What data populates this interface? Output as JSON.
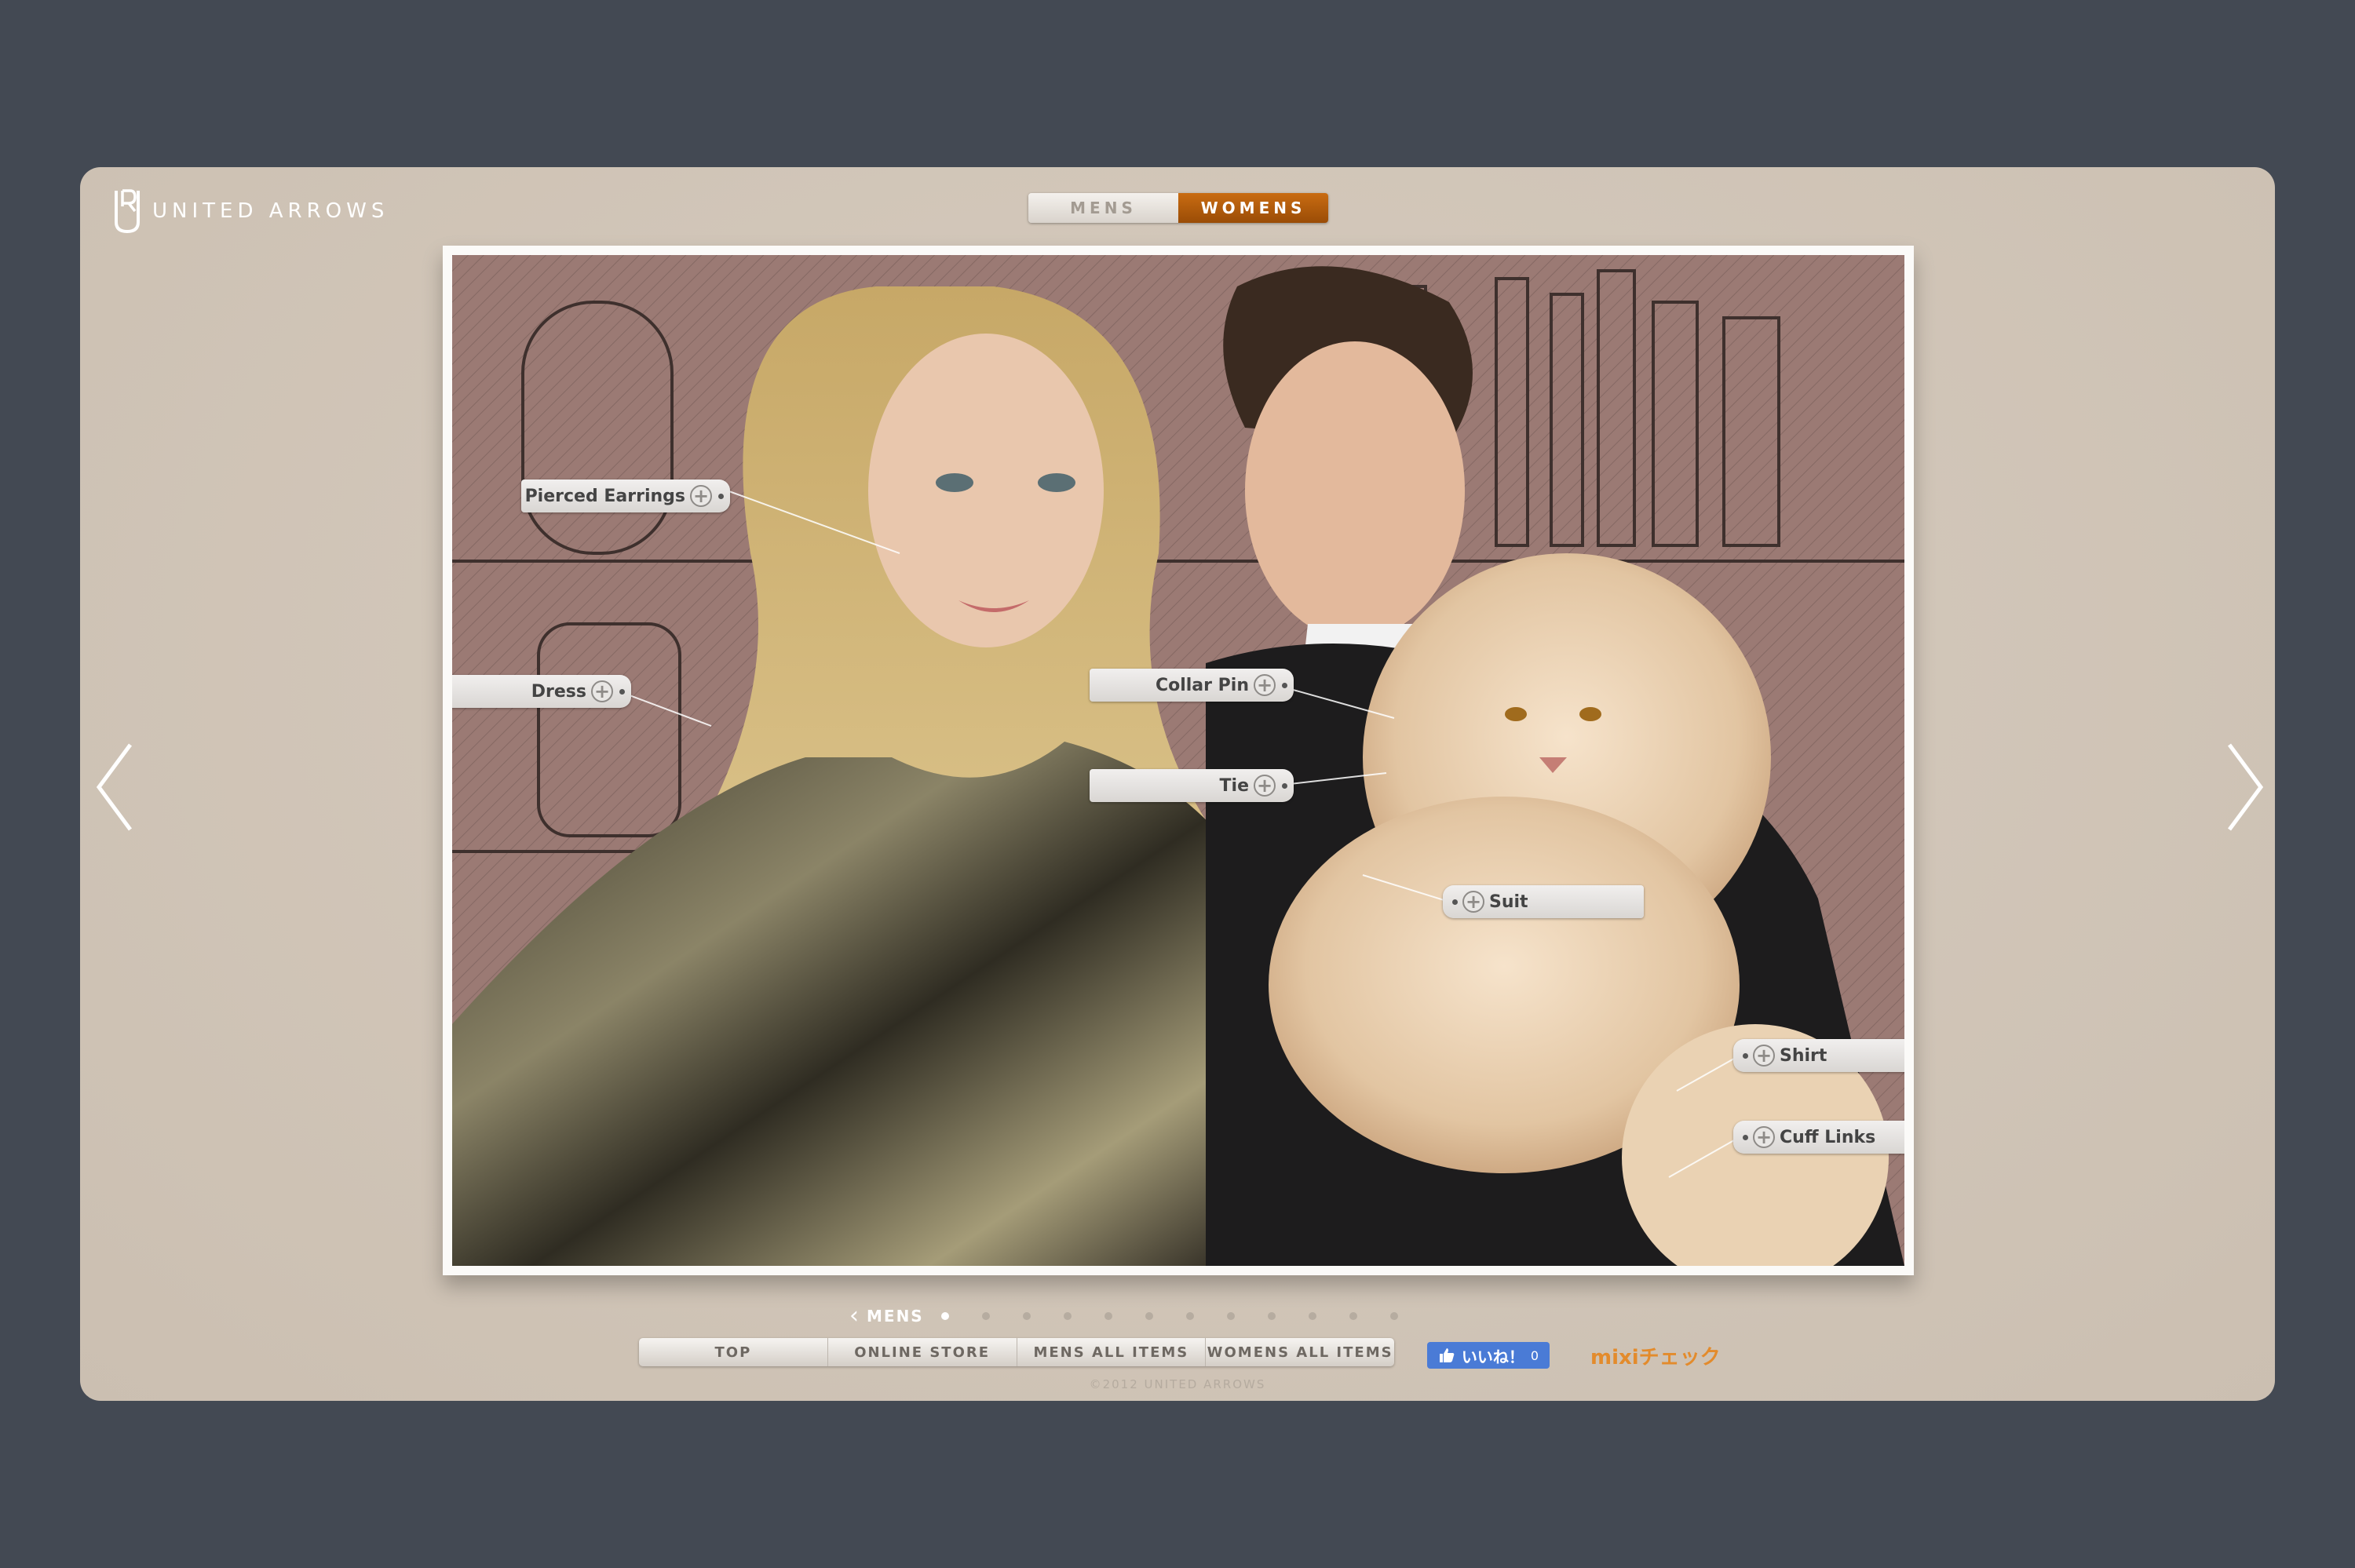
{
  "brand": {
    "name": "UNITED ARROWS"
  },
  "gender_toggle": {
    "mens": "MENS",
    "womens": "WOMENS",
    "active": "WOMENS"
  },
  "product_tags": [
    {
      "label": "Pierced Earrings"
    },
    {
      "label": "Dress"
    },
    {
      "label": "Collar Pin"
    },
    {
      "label": "Tie"
    },
    {
      "label": "Suit"
    },
    {
      "label": "Shirt"
    },
    {
      "label": "Cuff Links"
    }
  ],
  "carousel": {
    "section_label": "MENS",
    "page_count": 12,
    "active_index": 0
  },
  "footer_nav": [
    "TOP",
    "ONLINE STORE",
    "MENS ALL ITEMS",
    "WOMENS ALL ITEMS"
  ],
  "social": {
    "like_label": "いいね！",
    "like_count": "0",
    "mixi_label": "mixiチェック"
  },
  "copyright": "©2012 UNITED ARROWS",
  "colors": {
    "page_bg": "#434953",
    "panel_bg": "#cfc3b6",
    "accent": "#b35c0c",
    "like_blue": "#4a7bd6",
    "mixi_orange": "#e38b2c"
  },
  "icons": [
    "logo-mark-icon",
    "plus-circle-icon",
    "chevron-left-icon",
    "chevron-right-icon",
    "thumbs-up-icon"
  ]
}
